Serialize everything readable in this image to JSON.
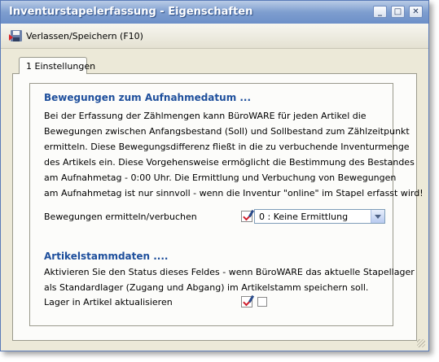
{
  "window": {
    "title": "Inventurstapelerfassung  - Eigenschaften",
    "buttons": {
      "minimize": "_",
      "maximize": "□",
      "close": "✕"
    }
  },
  "toolbar": {
    "save_label": "Verlassen/Speichern (F10)"
  },
  "tabs": [
    {
      "label": "1 Einstellungen",
      "active": true
    }
  ],
  "section1": {
    "heading": "Bewegungen zum Aufnahmedatum ...",
    "lines": [
      "Bei der Erfassung der Zählmengen kann BüroWARE für jeden Artikel die",
      "Bewegungen zwischen Anfangsbestand (Soll) und Sollbestand zum Zählzeitpunkt",
      "ermitteln. Diese Bewegungsdifferenz fließt in die zu verbuchende Inventurmenge",
      "des Artikels ein. Diese Vorgehensweise ermöglicht die Bestimmung des Bestandes",
      "am Aufnahmetag - 0:00 Uhr. Die Ermittlung und Verbuchung von Bewegungen",
      "am Aufnahmetag ist nur sinnvoll - wenn die Inventur \"online\" im Stapel erfasst wird!"
    ],
    "field_label": "Bewegungen ermitteln/verbuchen",
    "select_value": "0 : Keine Ermittlung"
  },
  "section2": {
    "heading": "Artikelstammdaten ....",
    "lines": [
      "Aktivieren Sie den Status dieses Feldes - wenn BüroWARE das aktuelle Stapellager",
      "als Standardlager (Zugang und Abgang) im Artikelstamm speichern soll."
    ],
    "field_label": "Lager in Artikel aktualisieren",
    "checkbox_checked": false
  },
  "colors": {
    "heading": "#1e4f9c",
    "titlebar": "#7e9ecf"
  }
}
